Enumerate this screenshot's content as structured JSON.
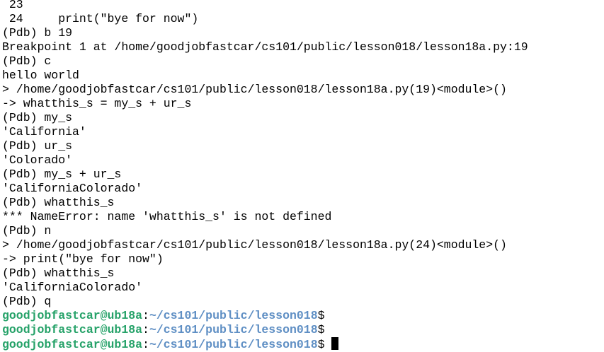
{
  "lines": [
    " 23",
    " 24     print(\"bye for now\")",
    "(Pdb) b 19",
    "Breakpoint 1 at /home/goodjobfastcar/cs101/public/lesson018/lesson18a.py:19",
    "(Pdb) c",
    "hello world",
    "> /home/goodjobfastcar/cs101/public/lesson018/lesson18a.py(19)<module>()",
    "-> whatthis_s = my_s + ur_s",
    "(Pdb) my_s",
    "'California'",
    "(Pdb) ur_s",
    "'Colorado'",
    "(Pdb) my_s + ur_s",
    "'CaliforniaColorado'",
    "(Pdb) whatthis_s",
    "*** NameError: name 'whatthis_s' is not defined",
    "(Pdb) n",
    "> /home/goodjobfastcar/cs101/public/lesson018/lesson18a.py(24)<module>()",
    "-> print(\"bye for now\")",
    "(Pdb) whatthis_s",
    "'CaliforniaColorado'",
    "(Pdb) q"
  ],
  "prompts": [
    {
      "user": "goodjobfastcar@ub18a",
      "sep": ":",
      "path": "~/cs101/public/lesson018",
      "symbol": "$"
    },
    {
      "user": "goodjobfastcar@ub18a",
      "sep": ":",
      "path": "~/cs101/public/lesson018",
      "symbol": "$"
    },
    {
      "user": "goodjobfastcar@ub18a",
      "sep": ":",
      "path": "~/cs101/public/lesson018",
      "symbol": "$ "
    }
  ],
  "colors": {
    "background": "#ffffff",
    "text": "#000000",
    "prompt_user": "#26a269",
    "prompt_path": "#5f8fc4"
  }
}
